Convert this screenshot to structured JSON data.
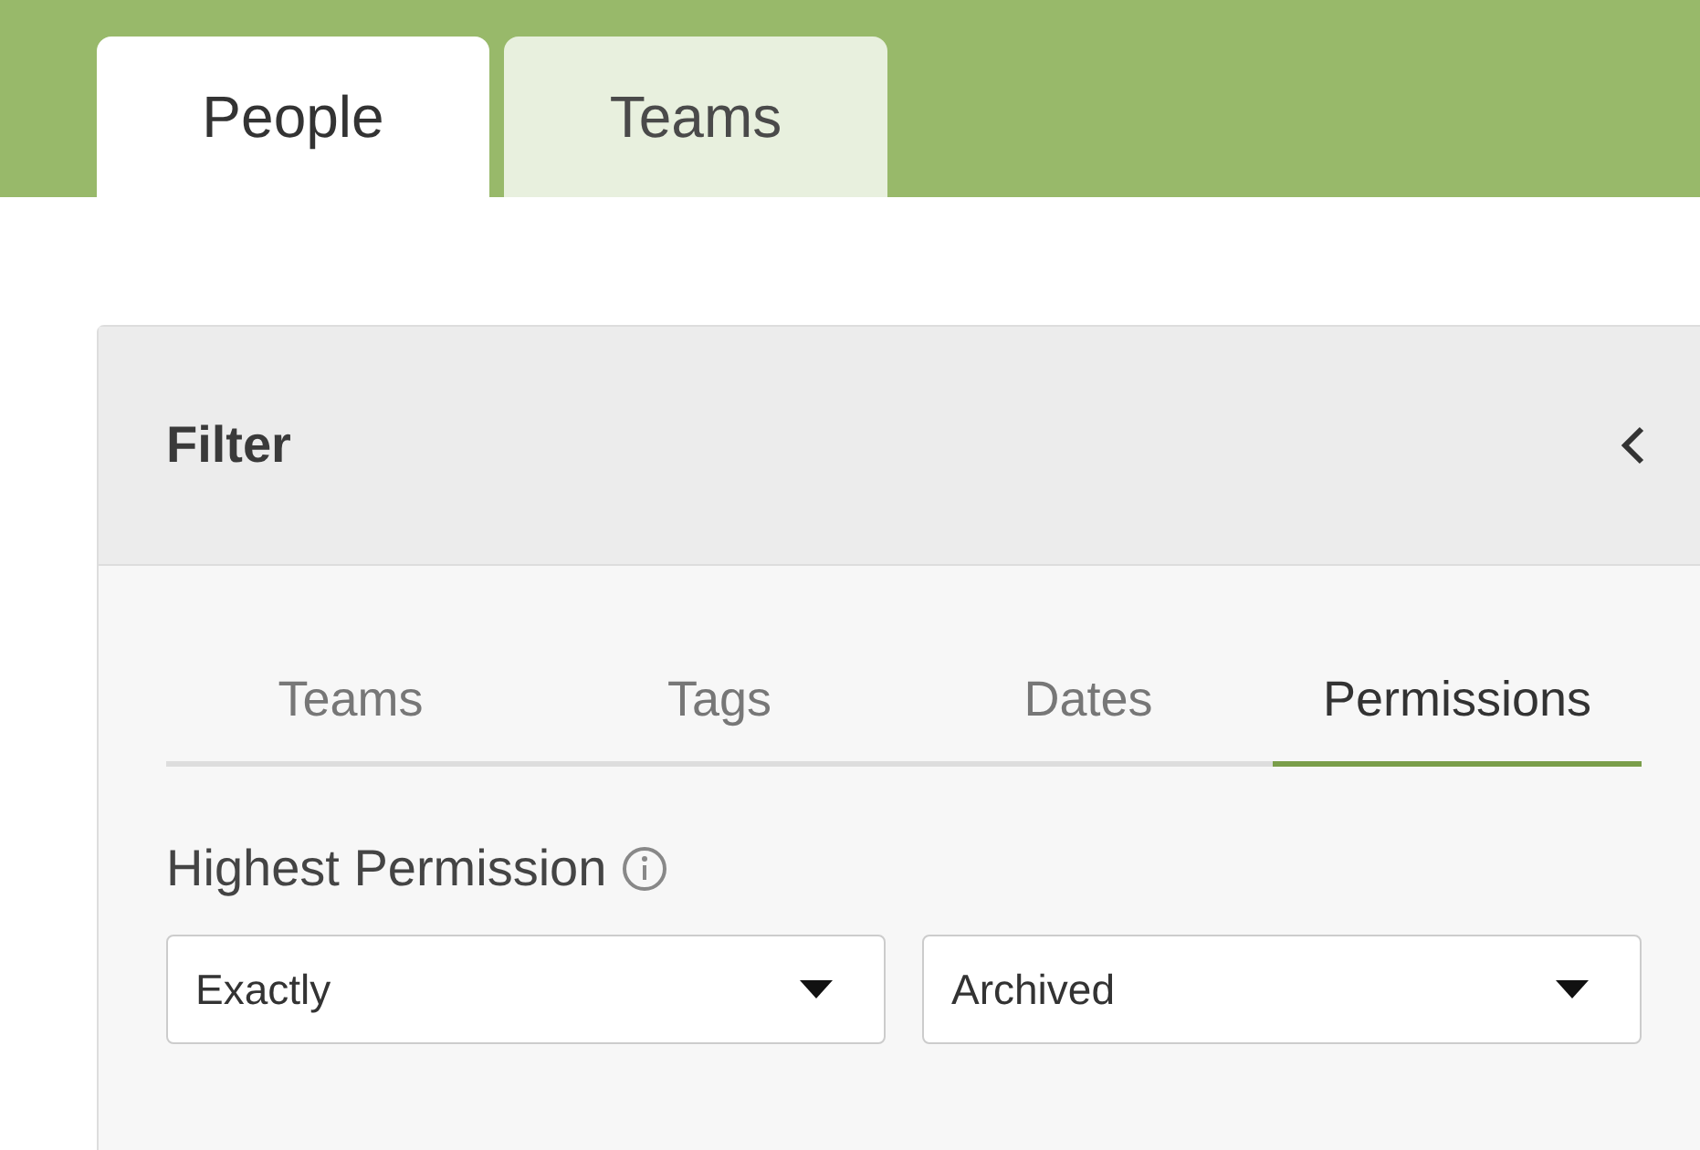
{
  "tabs": [
    {
      "label": "People",
      "selected": true
    },
    {
      "label": "Teams",
      "selected": false
    }
  ],
  "filter": {
    "title": "Filter",
    "tabs": [
      {
        "label": "Teams",
        "selected": false
      },
      {
        "label": "Tags",
        "selected": false
      },
      {
        "label": "Dates",
        "selected": false
      },
      {
        "label": "Permissions",
        "selected": true
      }
    ],
    "field_label": "Highest Permission",
    "selects": [
      {
        "value": "Exactly"
      },
      {
        "value": "Archived"
      }
    ]
  }
}
